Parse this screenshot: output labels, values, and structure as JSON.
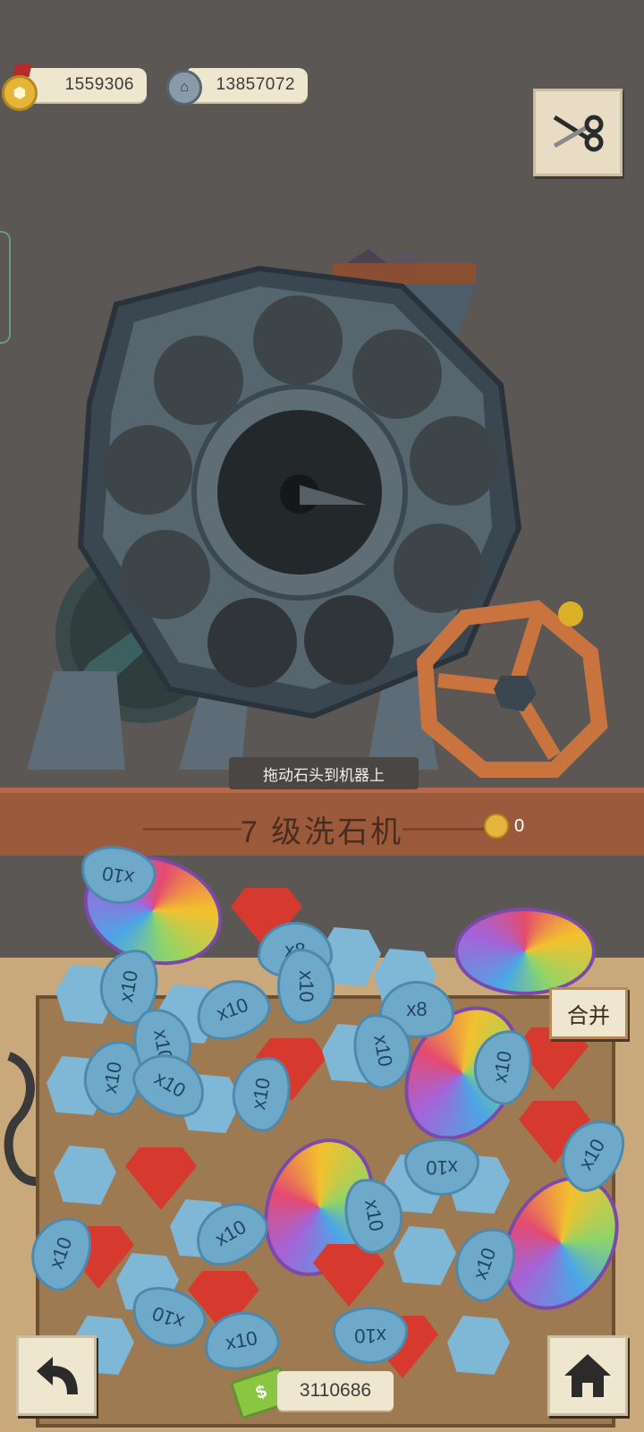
{
  "header": {
    "gold_medals": "1559306",
    "silver_coins": "13857072"
  },
  "icons": {
    "scissors": "scissors-icon",
    "back": "back-arrow-icon",
    "house": "house-icon",
    "money": "$"
  },
  "machine": {
    "hint": "拖动石头到机器上",
    "title": "7 级洗石机",
    "reward_count": "0"
  },
  "tray": {
    "merge_label": "合并",
    "multipliers": [
      "x10",
      "x10",
      "x8",
      "x10",
      "x10",
      "x10",
      "x8",
      "x10",
      "x10",
      "x10",
      "x10",
      "x10",
      "x10",
      "x10",
      "x10",
      "x10",
      "x10",
      "x10",
      "x10",
      "x10",
      "x10"
    ]
  },
  "footer": {
    "money": "3110686"
  }
}
